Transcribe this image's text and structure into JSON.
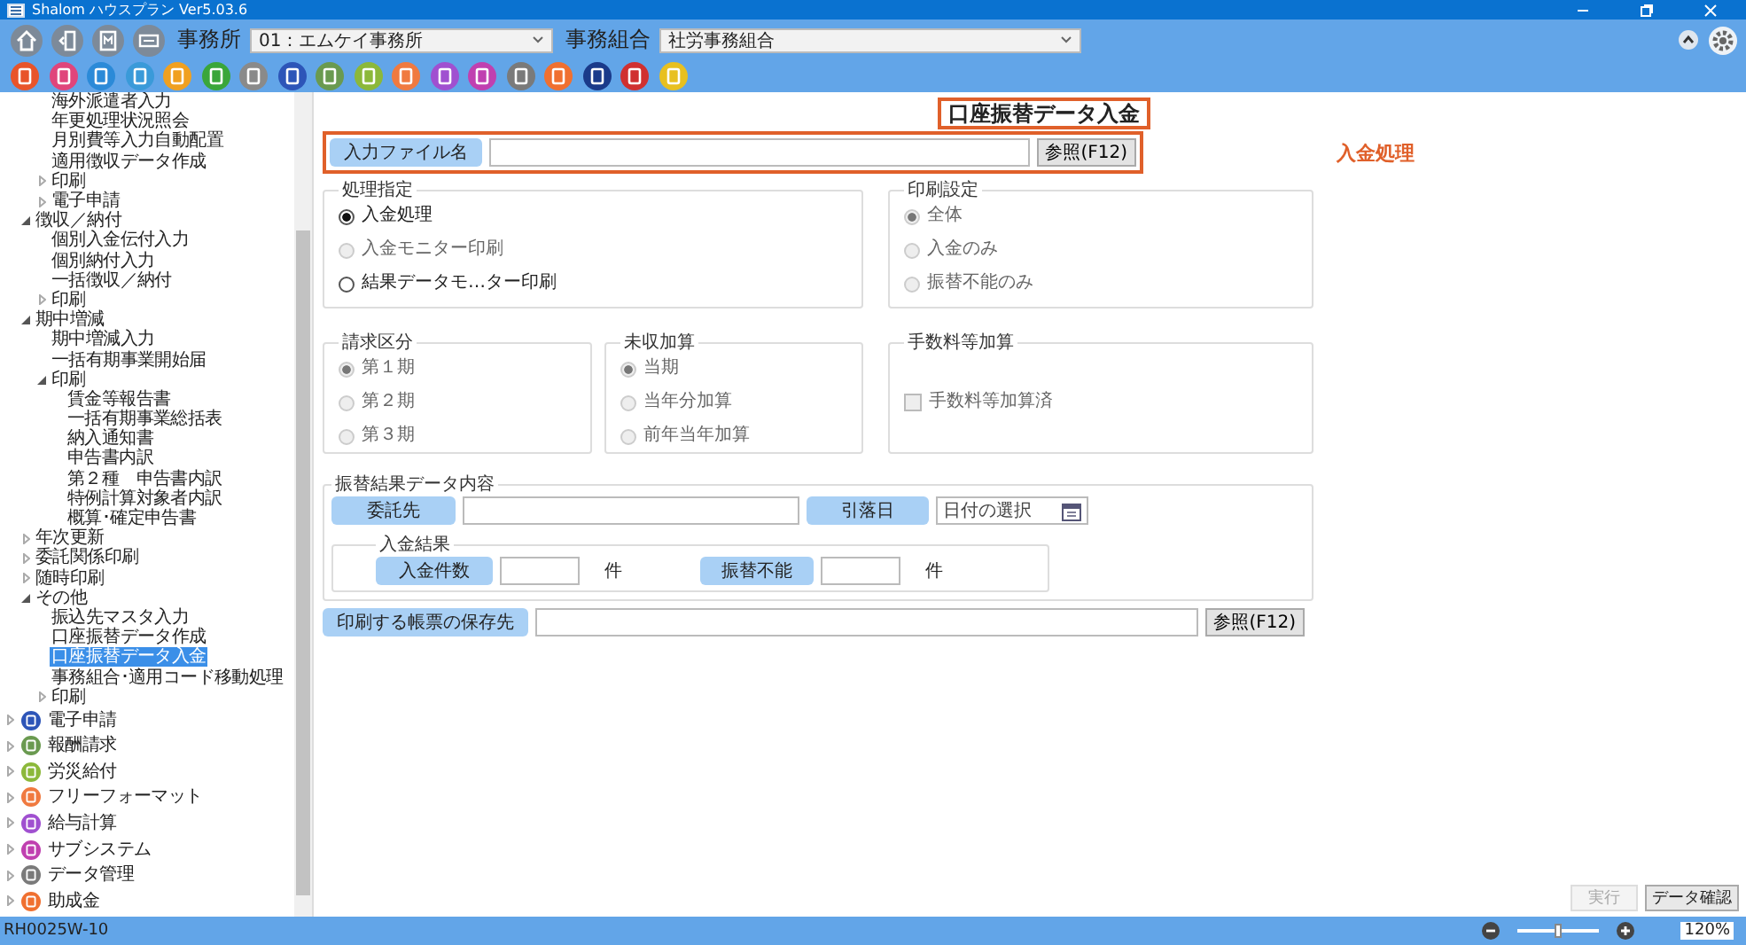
{
  "window": {
    "title": "Shalom ハウスプラン Ver5.03.6"
  },
  "toolbar": {
    "office_label": "事務所",
    "office_value": "01：エムケイ事務所",
    "union_label": "事務組合",
    "union_value": "社労事務組合",
    "app_icons": [
      {
        "color": "#e8542a"
      },
      {
        "color": "#e0457b"
      },
      {
        "color": "#2b8ad8"
      },
      {
        "color": "#3a9ad9"
      },
      {
        "color": "#f0a020"
      },
      {
        "color": "#3aa63a"
      },
      {
        "color": "#8a8a8a"
      },
      {
        "color": "#2d55b8"
      },
      {
        "color": "#6a9a50"
      },
      {
        "color": "#8cb83a"
      },
      {
        "color": "#f07a40"
      },
      {
        "color": "#a050d0"
      },
      {
        "color": "#c040b0"
      },
      {
        "color": "#7a7a7a"
      },
      {
        "color": "#f07030"
      },
      {
        "color": "#1a3a8a"
      },
      {
        "color": "#d03030"
      },
      {
        "color": "#e8c020"
      }
    ]
  },
  "sidebar": {
    "tree": [
      {
        "children": [
          {
            "children": [
              {
                "label": "海外派遣者入力",
                "selected": false
              },
              {
                "label": "年更処理状況照会",
                "selected": false
              },
              {
                "label": "月別費等入力自動配置",
                "selected": false
              },
              {
                "label": "適用徴収データ作成",
                "selected": false
              },
              {
                "label": "印刷",
                "selected": false,
                "expanded": false
              },
              {
                "label": "電子申請",
                "selected": false,
                "expanded": false
              }
            ]
          },
          {
            "label": "徴収／納付",
            "selected": false,
            "expanded": true,
            "children": [
              {
                "label": "個別入金伝付入力",
                "selected": false
              },
              {
                "label": "個別納付入力",
                "selected": false
              },
              {
                "label": "一括徴収／納付",
                "selected": false
              },
              {
                "label": "印刷",
                "selected": false,
                "expanded": false
              }
            ]
          },
          {
            "label": "期中増減",
            "selected": false,
            "expanded": true,
            "children": [
              {
                "label": "期中増減入力",
                "selected": false
              },
              {
                "label": "一括有期事業開始届",
                "selected": false
              },
              {
                "label": "印刷",
                "selected": false,
                "expanded": true,
                "children": [
                  {
                    "label": "賃金等報告書",
                    "selected": false
                  },
                  {
                    "label": "一括有期事業総括表",
                    "selected": false
                  },
                  {
                    "label": "納入通知書",
                    "selected": false
                  },
                  {
                    "label": "申告書内訳",
                    "selected": false
                  },
                  {
                    "label": "第２種　申告書内訳",
                    "selected": false
                  },
                  {
                    "label": "特例計算対象者内訳",
                    "selected": false
                  },
                  {
                    "label": "概算･確定申告書",
                    "selected": false
                  }
                ]
              }
            ]
          },
          {
            "label": "年次更新",
            "selected": false,
            "expanded": false
          },
          {
            "label": "委託関係印刷",
            "selected": false,
            "expanded": false
          },
          {
            "label": "随時印刷",
            "selected": false,
            "expanded": false
          },
          {
            "label": "その他",
            "selected": false,
            "expanded": true,
            "children": [
              {
                "label": "振込先マスタ入力",
                "selected": false
              },
              {
                "label": "口座振替データ作成",
                "selected": false
              },
              {
                "label": "口座振替データ入金",
                "selected": true
              },
              {
                "label": "事務組合･適用コード移動処理",
                "selected": false
              },
              {
                "label": "印刷",
                "selected": false,
                "expanded": false
              }
            ]
          }
        ]
      },
      {
        "label": "電子申請",
        "selected": false,
        "expanded": false,
        "color": "#2d55b8"
      },
      {
        "label": "報酬請求",
        "selected": false,
        "expanded": false,
        "color": "#6a9a50"
      },
      {
        "label": "労災給付",
        "selected": false,
        "expanded": false,
        "color": "#8cb83a"
      },
      {
        "label": "フリーフォーマット",
        "selected": false,
        "expanded": false,
        "color": "#f07a40"
      },
      {
        "label": "給与計算",
        "selected": false,
        "expanded": false,
        "color": "#a050d0"
      },
      {
        "label": "サブシステム",
        "selected": false,
        "expanded": false,
        "color": "#c040b0"
      },
      {
        "label": "データ管理",
        "selected": false,
        "expanded": false,
        "color": "#7a7a7a"
      },
      {
        "label": "助成金",
        "selected": false,
        "expanded": false,
        "color": "#f07030"
      }
    ]
  },
  "form": {
    "title": "口座振替データ入金",
    "annotation": "入金処理",
    "input_file": {
      "label": "入力ファイル名",
      "button": "参照(F12)"
    },
    "groups_top": [
      {
        "title": "処理指定",
        "options": [
          {
            "label": "入金処理",
            "selected": true,
            "disabled": false
          },
          {
            "label": "入金モニター印刷",
            "selected": false,
            "disabled": true
          },
          {
            "label": "結果データモ…ター印刷",
            "selected": false,
            "disabled": false
          }
        ]
      },
      {
        "title": "印刷設定",
        "options": [
          {
            "label": "全体",
            "selected": true,
            "disabled": true
          },
          {
            "label": "入金のみ",
            "selected": false,
            "disabled": true
          },
          {
            "label": "振替不能のみ",
            "selected": false,
            "disabled": true
          }
        ]
      }
    ],
    "groups_middle": [
      {
        "title": "請求区分",
        "kind": "radio",
        "options": [
          {
            "label": "第１期",
            "selected": true,
            "disabled": true
          },
          {
            "label": "第２期",
            "selected": false,
            "disabled": true
          },
          {
            "label": "第３期",
            "selected": false,
            "disabled": true
          }
        ]
      },
      {
        "title": "未収加算",
        "kind": "radio",
        "options": [
          {
            "label": "当期",
            "selected": true,
            "disabled": true
          },
          {
            "label": "当年分加算",
            "selected": false,
            "disabled": true
          },
          {
            "label": "前年当年加算",
            "selected": false,
            "disabled": true
          }
        ]
      },
      {
        "title": "手数料等加算",
        "kind": "checkbox",
        "options": [
          {
            "label": "手数料等加算済",
            "checked": false,
            "disabled": true
          }
        ]
      }
    ],
    "result_group": {
      "title": "振替結果データ内容",
      "consignor_label": "委託先",
      "date_label": "引落日",
      "date_placeholder": "日付の選択",
      "sub_title": "入金結果",
      "count_label": "入金件数",
      "count_unit": "件",
      "fail_label": "振替不能",
      "fail_unit": "件"
    },
    "save_path": {
      "label": "印刷する帳票の保存先",
      "button": "参照(F12)"
    },
    "actions": [
      {
        "label": "実行",
        "disabled": true
      },
      {
        "label": "データ確認",
        "disabled": false
      }
    ]
  },
  "status_bar": {
    "code": "RH0025W-10",
    "zoom": {
      "level": 0.5
    },
    "zoom_value": "120%"
  }
}
